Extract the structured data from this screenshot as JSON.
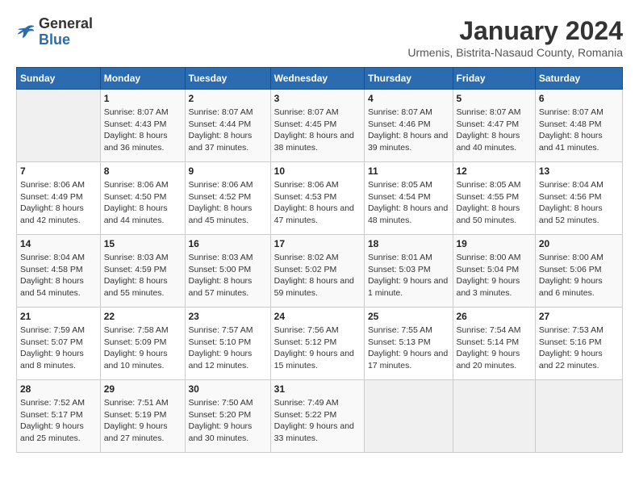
{
  "header": {
    "logo_line1": "General",
    "logo_line2": "Blue",
    "month": "January 2024",
    "location": "Urmenis, Bistrita-Nasaud County, Romania"
  },
  "weekdays": [
    "Sunday",
    "Monday",
    "Tuesday",
    "Wednesday",
    "Thursday",
    "Friday",
    "Saturday"
  ],
  "weeks": [
    [
      {
        "day": "",
        "empty": true
      },
      {
        "day": "1",
        "sunrise": "8:07 AM",
        "sunset": "4:43 PM",
        "daylight": "8 hours and 36 minutes."
      },
      {
        "day": "2",
        "sunrise": "8:07 AM",
        "sunset": "4:44 PM",
        "daylight": "8 hours and 37 minutes."
      },
      {
        "day": "3",
        "sunrise": "8:07 AM",
        "sunset": "4:45 PM",
        "daylight": "8 hours and 38 minutes."
      },
      {
        "day": "4",
        "sunrise": "8:07 AM",
        "sunset": "4:46 PM",
        "daylight": "8 hours and 39 minutes."
      },
      {
        "day": "5",
        "sunrise": "8:07 AM",
        "sunset": "4:47 PM",
        "daylight": "8 hours and 40 minutes."
      },
      {
        "day": "6",
        "sunrise": "8:07 AM",
        "sunset": "4:48 PM",
        "daylight": "8 hours and 41 minutes."
      }
    ],
    [
      {
        "day": "7",
        "sunrise": "8:06 AM",
        "sunset": "4:49 PM",
        "daylight": "8 hours and 42 minutes."
      },
      {
        "day": "8",
        "sunrise": "8:06 AM",
        "sunset": "4:50 PM",
        "daylight": "8 hours and 44 minutes."
      },
      {
        "day": "9",
        "sunrise": "8:06 AM",
        "sunset": "4:52 PM",
        "daylight": "8 hours and 45 minutes."
      },
      {
        "day": "10",
        "sunrise": "8:06 AM",
        "sunset": "4:53 PM",
        "daylight": "8 hours and 47 minutes."
      },
      {
        "day": "11",
        "sunrise": "8:05 AM",
        "sunset": "4:54 PM",
        "daylight": "8 hours and 48 minutes."
      },
      {
        "day": "12",
        "sunrise": "8:05 AM",
        "sunset": "4:55 PM",
        "daylight": "8 hours and 50 minutes."
      },
      {
        "day": "13",
        "sunrise": "8:04 AM",
        "sunset": "4:56 PM",
        "daylight": "8 hours and 52 minutes."
      }
    ],
    [
      {
        "day": "14",
        "sunrise": "8:04 AM",
        "sunset": "4:58 PM",
        "daylight": "8 hours and 54 minutes."
      },
      {
        "day": "15",
        "sunrise": "8:03 AM",
        "sunset": "4:59 PM",
        "daylight": "8 hours and 55 minutes."
      },
      {
        "day": "16",
        "sunrise": "8:03 AM",
        "sunset": "5:00 PM",
        "daylight": "8 hours and 57 minutes."
      },
      {
        "day": "17",
        "sunrise": "8:02 AM",
        "sunset": "5:02 PM",
        "daylight": "8 hours and 59 minutes."
      },
      {
        "day": "18",
        "sunrise": "8:01 AM",
        "sunset": "5:03 PM",
        "daylight": "9 hours and 1 minute."
      },
      {
        "day": "19",
        "sunrise": "8:00 AM",
        "sunset": "5:04 PM",
        "daylight": "9 hours and 3 minutes."
      },
      {
        "day": "20",
        "sunrise": "8:00 AM",
        "sunset": "5:06 PM",
        "daylight": "9 hours and 6 minutes."
      }
    ],
    [
      {
        "day": "21",
        "sunrise": "7:59 AM",
        "sunset": "5:07 PM",
        "daylight": "9 hours and 8 minutes."
      },
      {
        "day": "22",
        "sunrise": "7:58 AM",
        "sunset": "5:09 PM",
        "daylight": "9 hours and 10 minutes."
      },
      {
        "day": "23",
        "sunrise": "7:57 AM",
        "sunset": "5:10 PM",
        "daylight": "9 hours and 12 minutes."
      },
      {
        "day": "24",
        "sunrise": "7:56 AM",
        "sunset": "5:12 PM",
        "daylight": "9 hours and 15 minutes."
      },
      {
        "day": "25",
        "sunrise": "7:55 AM",
        "sunset": "5:13 PM",
        "daylight": "9 hours and 17 minutes."
      },
      {
        "day": "26",
        "sunrise": "7:54 AM",
        "sunset": "5:14 PM",
        "daylight": "9 hours and 20 minutes."
      },
      {
        "day": "27",
        "sunrise": "7:53 AM",
        "sunset": "5:16 PM",
        "daylight": "9 hours and 22 minutes."
      }
    ],
    [
      {
        "day": "28",
        "sunrise": "7:52 AM",
        "sunset": "5:17 PM",
        "daylight": "9 hours and 25 minutes."
      },
      {
        "day": "29",
        "sunrise": "7:51 AM",
        "sunset": "5:19 PM",
        "daylight": "9 hours and 27 minutes."
      },
      {
        "day": "30",
        "sunrise": "7:50 AM",
        "sunset": "5:20 PM",
        "daylight": "9 hours and 30 minutes."
      },
      {
        "day": "31",
        "sunrise": "7:49 AM",
        "sunset": "5:22 PM",
        "daylight": "9 hours and 33 minutes."
      },
      {
        "day": "",
        "empty": true
      },
      {
        "day": "",
        "empty": true
      },
      {
        "day": "",
        "empty": true
      }
    ]
  ]
}
